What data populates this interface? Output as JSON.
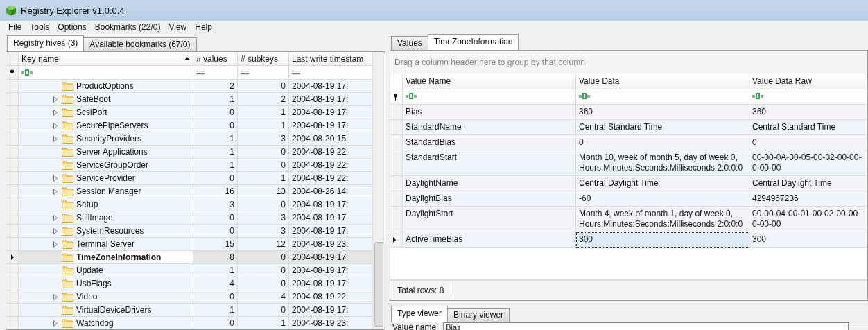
{
  "window": {
    "title": "Registry Explorer v1.0.0.4"
  },
  "menu": [
    "File",
    "Tools",
    "Options",
    "Bookmarks (22/0)",
    "View",
    "Help"
  ],
  "left_tabs": [
    {
      "label": "Registry hives (3)",
      "selected": true
    },
    {
      "label": "Available bookmarks (67/0)",
      "selected": false
    }
  ],
  "keys_table": {
    "columns": [
      {
        "label": "Key name",
        "kind": "text",
        "sorted": true
      },
      {
        "label": "# values",
        "kind": "number",
        "sorted": false
      },
      {
        "label": "# subkeys",
        "kind": "number",
        "sorted": false
      },
      {
        "label": "Last write timestam",
        "kind": "number",
        "sorted": false
      }
    ],
    "rows": [
      {
        "name": "ProductOptions",
        "expandable": false,
        "selected": false,
        "values": "2",
        "subkeys": "0",
        "timestamp": "2004-08-19 17:"
      },
      {
        "name": "SafeBoot",
        "expandable": true,
        "selected": false,
        "values": "1",
        "subkeys": "2",
        "timestamp": "2004-08-19 17:"
      },
      {
        "name": "ScsiPort",
        "expandable": true,
        "selected": false,
        "values": "0",
        "subkeys": "1",
        "timestamp": "2004-08-19 17:"
      },
      {
        "name": "SecurePipeServers",
        "expandable": true,
        "selected": false,
        "values": "0",
        "subkeys": "1",
        "timestamp": "2004-08-19 17:"
      },
      {
        "name": "SecurityProviders",
        "expandable": true,
        "selected": false,
        "values": "1",
        "subkeys": "3",
        "timestamp": "2004-08-20 15:"
      },
      {
        "name": "Server Applications",
        "expandable": false,
        "selected": false,
        "values": "1",
        "subkeys": "0",
        "timestamp": "2004-08-19 22:"
      },
      {
        "name": "ServiceGroupOrder",
        "expandable": false,
        "selected": false,
        "values": "1",
        "subkeys": "0",
        "timestamp": "2004-08-19 22:"
      },
      {
        "name": "ServiceProvider",
        "expandable": true,
        "selected": false,
        "values": "0",
        "subkeys": "1",
        "timestamp": "2004-08-19 22:"
      },
      {
        "name": "Session Manager",
        "expandable": true,
        "selected": false,
        "values": "16",
        "subkeys": "13",
        "timestamp": "2004-08-26 14:"
      },
      {
        "name": "Setup",
        "expandable": false,
        "selected": false,
        "values": "3",
        "subkeys": "0",
        "timestamp": "2004-08-19 17:"
      },
      {
        "name": "StillImage",
        "expandable": true,
        "selected": false,
        "values": "0",
        "subkeys": "3",
        "timestamp": "2004-08-19 17:"
      },
      {
        "name": "SystemResources",
        "expandable": true,
        "selected": false,
        "values": "0",
        "subkeys": "3",
        "timestamp": "2004-08-19 17:"
      },
      {
        "name": "Terminal Server",
        "expandable": true,
        "selected": false,
        "values": "15",
        "subkeys": "12",
        "timestamp": "2004-08-19 23:"
      },
      {
        "name": "TimeZoneInformation",
        "expandable": false,
        "selected": true,
        "values": "8",
        "subkeys": "0",
        "timestamp": "2004-08-19 17:"
      },
      {
        "name": "Update",
        "expandable": false,
        "selected": false,
        "values": "1",
        "subkeys": "0",
        "timestamp": "2004-08-19 17:"
      },
      {
        "name": "UsbFlags",
        "expandable": false,
        "selected": false,
        "values": "4",
        "subkeys": "0",
        "timestamp": "2004-08-19 17:"
      },
      {
        "name": "Video",
        "expandable": true,
        "selected": false,
        "values": "0",
        "subkeys": "4",
        "timestamp": "2004-08-19 22:"
      },
      {
        "name": "VirtualDeviceDrivers",
        "expandable": false,
        "selected": false,
        "values": "1",
        "subkeys": "0",
        "timestamp": "2004-08-19 17:"
      },
      {
        "name": "Watchdog",
        "expandable": true,
        "selected": false,
        "values": "0",
        "subkeys": "1",
        "timestamp": "2004-08-19 23:"
      }
    ]
  },
  "right_tabs": [
    {
      "label": "Values",
      "selected": false
    },
    {
      "label": "TimeZoneInformation",
      "selected": true
    }
  ],
  "values_table": {
    "group_hint": "Drag a column header here to group by that column",
    "columns": [
      "Value Name",
      "Value Data",
      "Value Data Raw"
    ],
    "rows": [
      {
        "name": "Bias",
        "data": "360",
        "raw": [
          "360"
        ],
        "selected": false
      },
      {
        "name": "StandardName",
        "data": "Central Standard Time",
        "raw": [
          "Central Standard Time"
        ],
        "selected": false
      },
      {
        "name": "StandardBias",
        "data": "0",
        "raw": [
          "0"
        ],
        "selected": false
      },
      {
        "name": "StandardStart",
        "data": "Month 10, week of month 5, day of week 0, Hours:Minutes:Seconds:Milliseconds 2:0:0:0",
        "raw": [
          "00-00-0A-00-05-00-02-00-00-",
          "0-00-00"
        ],
        "selected": false
      },
      {
        "name": "DaylightName",
        "data": "Central Daylight Time",
        "raw": [
          "Central Daylight Time"
        ],
        "selected": false
      },
      {
        "name": "DaylightBias",
        "data": "-60",
        "raw": [
          "4294967236"
        ],
        "selected": false
      },
      {
        "name": "DaylightStart",
        "data": "Month 4, week of month 1, day of week 0, Hours:Minutes:Seconds:Milliseconds 2:0:0:0",
        "raw": [
          "00-00-04-00-01-00-02-00-00-",
          "0-00-00"
        ],
        "selected": false
      },
      {
        "name": "ActiveTimeBias",
        "data": "300",
        "raw": [
          "300"
        ],
        "selected": true
      }
    ],
    "footer": "Total rows: 8"
  },
  "viewer_tabs": [
    {
      "label": "Type viewer",
      "selected": true
    },
    {
      "label": "Binary viewer",
      "selected": false
    }
  ],
  "type_viewer": {
    "label": "Value name",
    "value": "Bias"
  }
}
